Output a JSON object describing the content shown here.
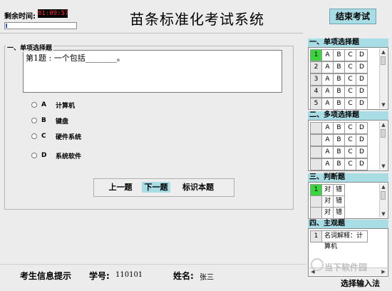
{
  "header": {
    "timer_label": "剩余时间:",
    "timer_value": "01:09:57",
    "timer_progress": 0.02,
    "title": "苗条标准化考试系统",
    "end_button": "结束考试"
  },
  "question_panel": {
    "section_title": "一、单项选择题",
    "question_text": "第1题 :  一个包括________。",
    "options": [
      {
        "letter": "A",
        "text": "计算机"
      },
      {
        "letter": "B",
        "text": "键盘"
      },
      {
        "letter": "C",
        "text": "硬件系统"
      },
      {
        "letter": "D",
        "text": "系统软件"
      }
    ]
  },
  "navigation": {
    "prev": "上一题",
    "next": "下一题",
    "mark": "标识本题"
  },
  "footer": {
    "info_label": "考生信息提示",
    "id_label": "学号:",
    "id_value": "110101",
    "name_label": "姓名:",
    "name_value": "张三"
  },
  "right_panel": {
    "single_choice": {
      "title": "一、单项选择题",
      "rows": [
        {
          "num": "1",
          "active": true,
          "options": [
            "A",
            "B",
            "C",
            "D"
          ]
        },
        {
          "num": "2",
          "active": false,
          "options": [
            "A",
            "B",
            "C",
            "D"
          ]
        },
        {
          "num": "3",
          "active": false,
          "options": [
            "A",
            "B",
            "C",
            "D"
          ]
        },
        {
          "num": "4",
          "active": false,
          "options": [
            "A",
            "B",
            "C",
            "D"
          ]
        },
        {
          "num": "5",
          "active": false,
          "options": [
            "A",
            "B",
            "C",
            "D"
          ]
        }
      ]
    },
    "multi_choice": {
      "title": "二、多项选择题",
      "rows": [
        {
          "options": [
            "A",
            "B",
            "C",
            "D"
          ]
        },
        {
          "options": [
            "A",
            "B",
            "C",
            "D"
          ]
        },
        {
          "options": [
            "A",
            "B",
            "C",
            "D"
          ]
        },
        {
          "options": [
            "A",
            "B",
            "C",
            "D"
          ]
        }
      ]
    },
    "true_false": {
      "title": "三、判断题",
      "rows": [
        {
          "num": "1",
          "active": true,
          "options": [
            "对",
            "错"
          ]
        },
        {
          "num": "",
          "active": false,
          "options": [
            "对",
            "错"
          ]
        },
        {
          "num": "",
          "active": false,
          "options": [
            "对",
            "错"
          ]
        }
      ]
    },
    "subjective": {
      "title": "四、主观题",
      "rows": [
        {
          "num": "1",
          "text": "名词解释：计算机"
        }
      ]
    },
    "input_method_button": "选择输入法"
  },
  "watermark": "当下软件园",
  "colors": {
    "accent": "#a8dde6",
    "active_green": "#3cd43c",
    "timer_text": "#ff3030"
  }
}
